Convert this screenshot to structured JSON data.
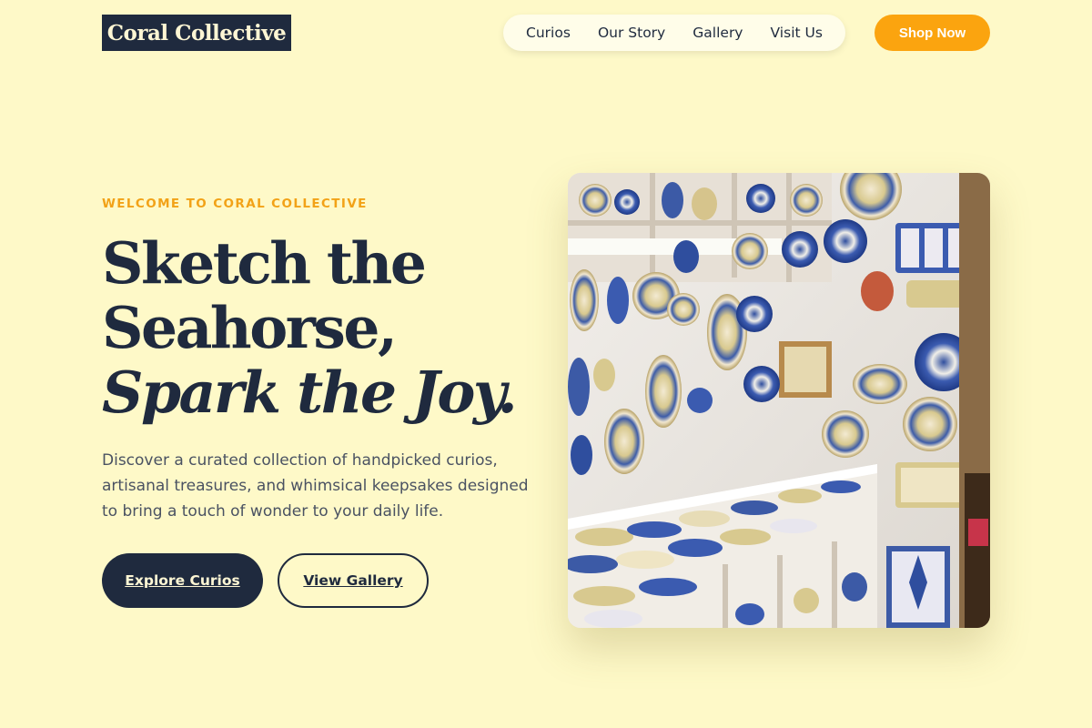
{
  "header": {
    "logo": "Coral Collective",
    "nav": [
      "Curios",
      "Our Story",
      "Gallery",
      "Visit Us"
    ],
    "cta": "Shop Now"
  },
  "hero": {
    "eyebrow": "WELCOME TO CORAL COLLECTIVE",
    "headline_line1": "Sketch the",
    "headline_line2": "Seahorse,",
    "headline_line3": "Spark the Joy.",
    "description": "Discover a curated collection of handpicked curios, artisanal treasures, and whimsical keepsakes designed to bring a touch of wonder to your daily life.",
    "primary_button": "Explore Curios",
    "secondary_button": "View Gallery",
    "image_alt": "Shop interior with shelves and walls full of hand-painted ceramic plates and bowls"
  },
  "colors": {
    "background": "#fef9c8",
    "navy": "#1f2a3e",
    "accent": "#fba40f",
    "accent_text": "#f2a217"
  }
}
